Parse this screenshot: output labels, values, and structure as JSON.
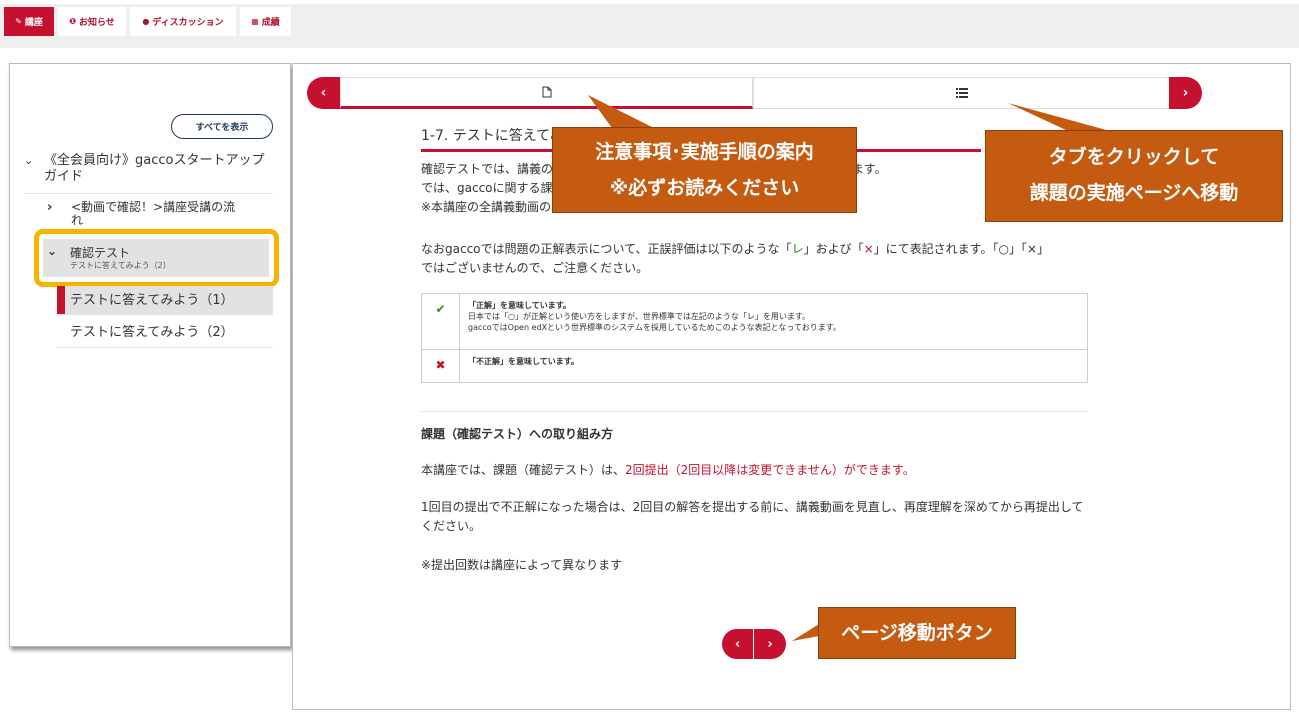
{
  "nav": {
    "tabs": [
      {
        "icon": "✎",
        "label": "講座",
        "active": true
      },
      {
        "icon": "❶",
        "label": "お知らせ",
        "active": false
      },
      {
        "icon": "●",
        "label": "ディスカッション",
        "active": false
      },
      {
        "icon": "▦",
        "label": "成績",
        "active": false
      }
    ]
  },
  "sidebar": {
    "show_all": "すべてを表示",
    "course_title": "《全会員向け》gaccoスタートアップガイド",
    "sections": [
      {
        "label": "<動画で確認！>講座受講の流れ"
      },
      {
        "label": "確認テスト",
        "sub": "テストに答えてみよう（2）"
      }
    ],
    "units": [
      "テストに答えてみよう（1）",
      "テストに答えてみよう（2）"
    ]
  },
  "main": {
    "unit_title": "1-7. テストに答えてみよう",
    "intro_lines": [
      "確認テストでは、講義の内容についての理解度を確認することで、理解をめざします。",
      "では、gaccoに関する課題が出題されます。",
      "※本講座の全講義動画の中から出題しています。"
    ],
    "notice_line1": "なおgaccoでは問題の正解表示について、正誤評価は以下のような「",
    "notice_check": "レ",
    "notice_mid": "」および「",
    "notice_cross": "×",
    "notice_end": "」にて表記されます。「○」「×」",
    "notice_line2": "ではございませんので、ご注意ください。",
    "legend": {
      "correct_title": "「正解」を意味しています。",
      "correct_line1": "日本では「○」が正解という使い方をしますが、世界標準では左記のような「レ」を用います。",
      "correct_line2": "gaccoではOpen edXという世界標準のシステムを採用しているためこのような表記となっております。",
      "wrong_title": "「不正解」を意味しています。"
    },
    "how_to_heading": "課題（確認テスト）への取り組み方",
    "submit_prefix": "本講座では、課題（確認テスト）は、",
    "submit_red": "2回提出（2回目以降は変更できません）ができます。",
    "retry_text": "1回目の提出で不正解になった場合は、2回目の解答を提出する前に、講義動画を見直し、再度理解を深めてから再提出してください。",
    "note_text": "※提出回数は講座によって異なります"
  },
  "callouts": {
    "notice_line1": "注意事項･実施手順の案内",
    "notice_line2": "※必ずお読みください",
    "tab_line1": "タブをクリックして",
    "tab_line2": "課題の実施ページへ移動",
    "pager": "ページ移動ボタン"
  },
  "colors": {
    "accent": "#c6102f",
    "callout": "#c55a11",
    "highlight": "#f5b400"
  }
}
